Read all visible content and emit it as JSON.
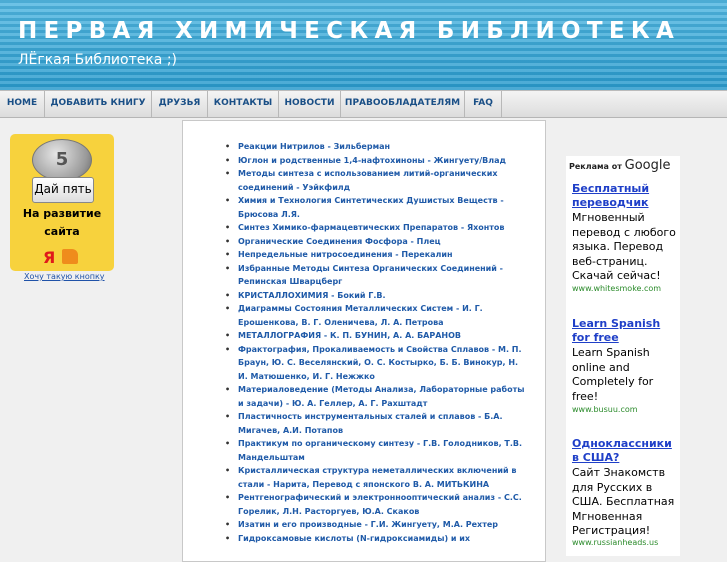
{
  "header": {
    "title": "ПЕРВАЯ ХИМИЧЕСКАЯ БИБЛИОТЕКА",
    "subtitle": "ЛЁгкая Библиотека ;)"
  },
  "nav": {
    "items": [
      {
        "label": "HOME"
      },
      {
        "label": "ДОБАВИТЬ КНИГУ"
      },
      {
        "label": "ДРУЗЬЯ"
      },
      {
        "label": "КОНТАКТЫ"
      },
      {
        "label": "НОВОСТИ"
      },
      {
        "label": "ПРАВООБЛАДАТЕЛЯМ"
      },
      {
        "label": "FAQ"
      }
    ]
  },
  "donate": {
    "coin_label": "5",
    "button_label": "Дай пять",
    "text": "На развитие сайта",
    "yandex_glyph": "Я",
    "link": "Хочу такую кнопку"
  },
  "books": [
    "Реакции Нитрилов - Зильберман",
    "Юглон и родственные 1,4-нафтохиноны - Жингуету/Влад",
    "Методы синтеза с использованием литий-органических соединений - Уэйкфилд",
    "Химия и Технология Синтетических Душистых Веществ - Брюсова Л.Я.",
    "Синтез Химико-фармацевтических Препаратов - Яхонтов",
    "Органические Соединения Фосфора - Плец",
    "Непредельные нитросоединения - Перекалин",
    "Избранные Методы Синтеза Органических Соединений - Репинская Шварцберг",
    "КРИСТАЛЛОХИМИЯ - Бокий Г.В.",
    "Диаграммы Состояния Металлических Систем - И. Г. Ерошенкова, В. Г. Оленичева, Л. А. Петрова",
    "МЕТАЛЛОГРАФИЯ - К. П. БУНИН, А. А. БАРАНОВ",
    "Фрактография, Прокаливаемость и Свойства Сплавов - М. П. Браун, Ю. С. Веселянский, О. С. Костырко, Б. Б. Винокур, Н. И. Матюшенко, И. Г. Нежжко",
    "Материаловедение (Методы Анализа, Лабораторные работы и задачи) - Ю. А. Геллер, А. Г. Рахштадт",
    "Пластичность инструментальных сталей и сплавов - Б.А. Мигачев, А.И. Потапов",
    "Практикум по органическому синтезу - Г.В. Голодников, Т.В. Мандельштам",
    "Кристаллическая структура неметаллических включений в стали - Нарита, Перевод с японского В. А. МИТЬКИНА",
    "Рентгенографический и электроннооптический анализ - С.С. Горелик, Л.Н. Расторгуев, Ю.А. Скаков",
    "Изатин и его производные - Г.И. Жингуету, М.А. Рехтер",
    "Гидроксамовые кислоты (N-гидроксиамиды) и их"
  ],
  "ads": {
    "label": "Реклама от",
    "google": "Google",
    "items": [
      {
        "title": "Бесплатный переводчик",
        "text": "Мгновенный перевод с любого языка. Перевод веб-страниц. Скачай сейчас!",
        "url": "www.whitesmoke.com"
      },
      {
        "title": "Learn Spanish for free",
        "text": "Learn Spanish online and Completely for free!",
        "url": "www.busuu.com"
      },
      {
        "title": "Одноклассники в США?",
        "text": "Сайт Знакомств для Русских в США. Бесплатная Мгновенная Регистрация!",
        "url": "www.russianheads.us"
      }
    ]
  }
}
